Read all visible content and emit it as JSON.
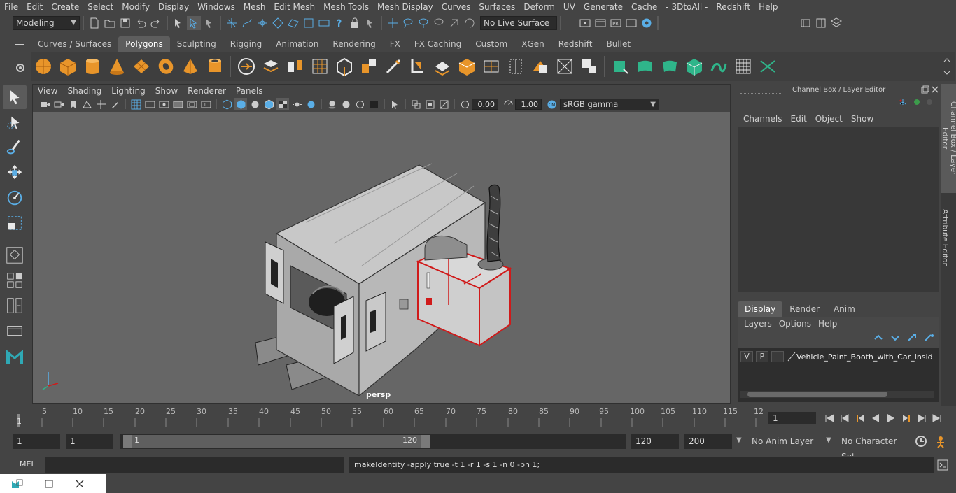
{
  "menubar": {
    "items": [
      "File",
      "Edit",
      "Create",
      "Select",
      "Modify",
      "Display",
      "Windows",
      "Mesh",
      "Edit Mesh",
      "Mesh Tools",
      "Mesh Display",
      "Curves",
      "Surfaces",
      "Deform",
      "UV",
      "Generate",
      "Cache",
      "- 3DtoAll -",
      "Redshift",
      "Help"
    ]
  },
  "statusline": {
    "mode": "Modeling",
    "live_surface": "No Live Surface"
  },
  "shelf": {
    "tabs": [
      "Curves / Surfaces",
      "Polygons",
      "Sculpting",
      "Rigging",
      "Animation",
      "Rendering",
      "FX",
      "FX Caching",
      "Custom",
      "XGen",
      "Redshift",
      "Bullet"
    ],
    "active_tab": "Polygons"
  },
  "viewport": {
    "menu": [
      "View",
      "Shading",
      "Lighting",
      "Show",
      "Renderer",
      "Panels"
    ],
    "exposure": "0.00",
    "gamma": "1.00",
    "color_space": "sRGB gamma",
    "camera_label": "persp"
  },
  "channel_box": {
    "title": "Channel Box / Layer Editor",
    "menu": [
      "Channels",
      "Edit",
      "Object",
      "Show"
    ],
    "layer_tabs": [
      "Display",
      "Render",
      "Anim"
    ],
    "active_layer_tab": "Display",
    "layer_menu": [
      "Layers",
      "Options",
      "Help"
    ],
    "layer_row": {
      "v": "V",
      "p": "P",
      "name": "Vehicle_Paint_Booth_with_Car_Inside"
    }
  },
  "side_tabs": [
    "Channel Box / Layer Editor",
    "Attribute Editor"
  ],
  "timeline": {
    "ticks": [
      "5",
      "10",
      "15",
      "20",
      "25",
      "30",
      "35",
      "40",
      "45",
      "50",
      "55",
      "60",
      "65",
      "70",
      "75",
      "80",
      "85",
      "90",
      "95",
      "100",
      "105",
      "110",
      "115",
      "12"
    ],
    "start_marker": "1",
    "current_frame": "1"
  },
  "range": {
    "start": "1",
    "anim_start": "1",
    "slider_start": "1",
    "slider_end": "120",
    "end": "120",
    "anim_end": "200",
    "anim_layer": "No Anim Layer",
    "character_set": "No Character Set"
  },
  "command": {
    "language": "MEL",
    "result": "makeIdentity -apply true -t 1 -r 1 -s 1 -n 0 -pn 1;"
  },
  "colors": {
    "accent_blue": "#5aaee6",
    "selection_red": "#d01a1a",
    "shelf_green": "#2fb58a"
  }
}
